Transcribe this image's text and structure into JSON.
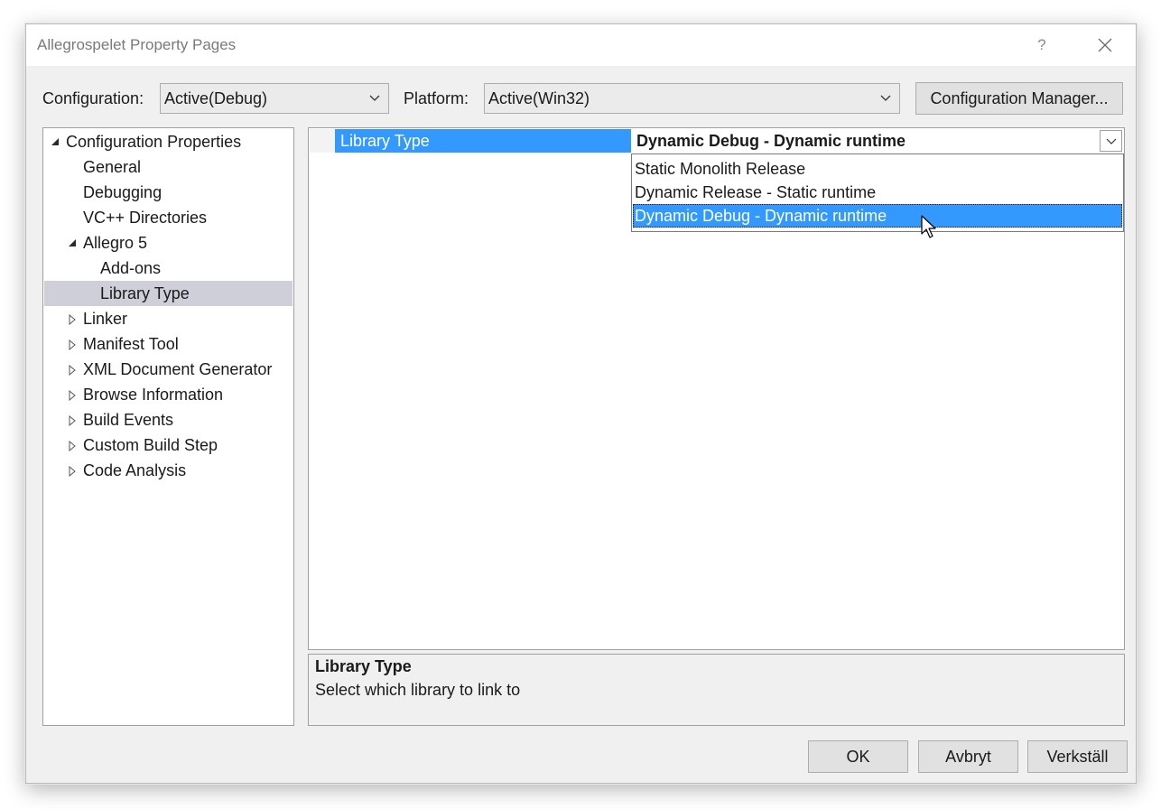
{
  "window": {
    "title": "Allegrospelet Property Pages",
    "help_label": "?",
    "close_icon": "close-icon"
  },
  "config_bar": {
    "configuration_label": "Configuration:",
    "configuration_value": "Active(Debug)",
    "platform_label": "Platform:",
    "platform_value": "Active(Win32)",
    "manager_button": "Configuration Manager..."
  },
  "tree": {
    "items": [
      {
        "label": "Configuration Properties",
        "state": "expanded"
      },
      {
        "label": "General",
        "state": "leaf"
      },
      {
        "label": "Debugging",
        "state": "leaf"
      },
      {
        "label": "VC++ Directories",
        "state": "leaf"
      },
      {
        "label": "Allegro 5",
        "state": "expanded"
      },
      {
        "label": "Add-ons",
        "state": "leaf"
      },
      {
        "label": "Library Type",
        "state": "leaf",
        "selected": true
      },
      {
        "label": "Linker",
        "state": "collapsed"
      },
      {
        "label": "Manifest Tool",
        "state": "collapsed"
      },
      {
        "label": "XML Document Generator",
        "state": "collapsed"
      },
      {
        "label": "Browse Information",
        "state": "collapsed"
      },
      {
        "label": "Build Events",
        "state": "collapsed"
      },
      {
        "label": "Custom Build Step",
        "state": "collapsed"
      },
      {
        "label": "Code Analysis",
        "state": "collapsed"
      }
    ]
  },
  "property_grid": {
    "property_name": "Library Type",
    "property_value": "Dynamic Debug - Dynamic runtime",
    "options": [
      "Static Monolith Release",
      "Dynamic Release - Static runtime",
      "Dynamic Debug - Dynamic runtime"
    ],
    "highlighted_option": "Dynamic Debug - Dynamic runtime"
  },
  "description": {
    "title": "Library Type",
    "text": "Select which library to link to"
  },
  "buttons": {
    "ok": "OK",
    "cancel": "Avbryt",
    "apply": "Verkställ"
  },
  "colors": {
    "selection_blue": "#3399ff",
    "tree_selected": "#cfcfd9",
    "dialog_bg": "#f0f0f0"
  }
}
